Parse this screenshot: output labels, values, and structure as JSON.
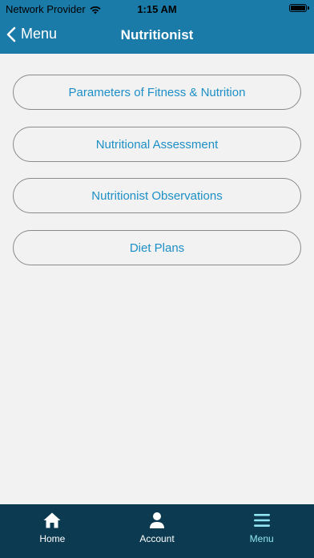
{
  "status_bar": {
    "carrier": "Network Provider",
    "time": "1:15 AM"
  },
  "nav": {
    "back_label": "Menu",
    "title": "Nutritionist"
  },
  "options": [
    "Parameters of Fitness & Nutrition",
    "Nutritional Assessment",
    "Nutritionist Observations",
    "Diet Plans"
  ],
  "tabs": [
    {
      "label": "Home",
      "icon": "home-icon"
    },
    {
      "label": "Account",
      "icon": "account-icon"
    },
    {
      "label": "Menu",
      "icon": "menu-icon",
      "active": true
    }
  ],
  "colors": {
    "header": "#1a7aa8",
    "accent": "#1d8fc6",
    "tab_bar": "#0b3a51",
    "active_tab": "#8fe6f2"
  }
}
